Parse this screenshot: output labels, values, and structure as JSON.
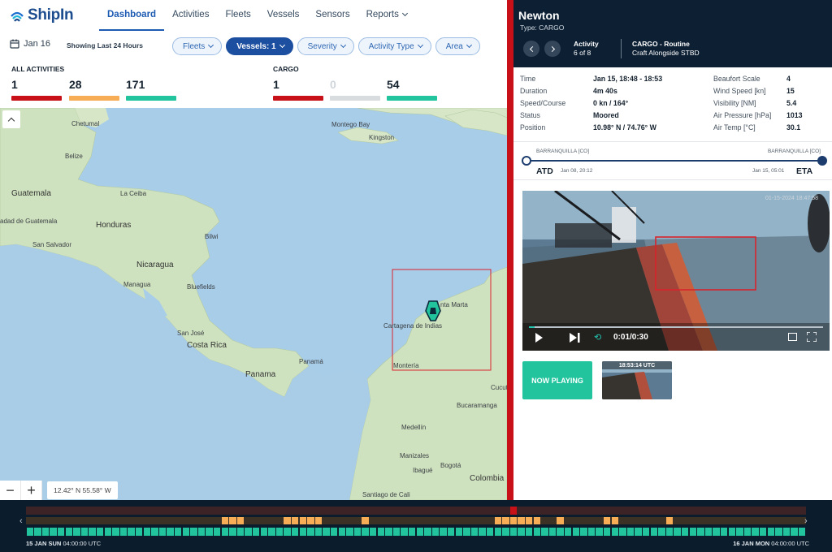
{
  "app": {
    "name": "ShipIn"
  },
  "nav": {
    "items": [
      "Dashboard",
      "Activities",
      "Fleets",
      "Vessels",
      "Sensors",
      "Reports"
    ],
    "active": "Dashboard"
  },
  "filters": {
    "date": "Jan 16",
    "showing": "Showing Last 24 Hours",
    "pills": [
      "Fleets",
      "Vessels: 1",
      "Severity",
      "Activity Type",
      "Area"
    ]
  },
  "stats": {
    "all": {
      "title": "ALL ACTIVITIES",
      "values": [
        "1",
        "28",
        "171"
      ]
    },
    "cargo": {
      "title": "CARGO",
      "values": [
        "1",
        "0",
        "54"
      ]
    },
    "colors": {
      "high": "#c81018",
      "medium": "#f6ad55",
      "low": "#22c49e",
      "none": "#d8dcdf"
    }
  },
  "map": {
    "coords": "12.42° N 55.58° W",
    "labels": {
      "chetumal": "Chetumal",
      "belize": "Belize",
      "guatemala": "Guatemala",
      "laceiba": "La Ceiba",
      "honduras": "Honduras",
      "sanpedro": "adad de Guatemala",
      "bilwi": "Bilwi",
      "salvador": "San Salvador",
      "nicaragua": "Nicaragua",
      "managua": "Managua",
      "bluefields": "Bluefields",
      "sanjose": "San José",
      "costarica": "Costa Rica",
      "panama": "Panamá",
      "panama2": "Panama",
      "montego": "Montego Bay",
      "kingston": "Kingston",
      "santamarta": "nta Marta",
      "cartagena": "Cartagena de Indias",
      "monteria": "Montería",
      "cucuta": "Cucut",
      "bucaramanga": "Bucaramanga",
      "medellin": "Medellín",
      "manizales": "Manizales",
      "ibague": "Ibagué",
      "bogota": "Bogotá",
      "colombia": "Colombia",
      "cali": "Santiago de Cali"
    }
  },
  "vessel": {
    "name": "Newton",
    "type": "Type: CARGO",
    "activity_title": "Activity",
    "activity_index": "6 of 8",
    "category": "CARGO - Routine",
    "activity_name": "Craft Alongside STBD"
  },
  "details": {
    "left": [
      {
        "label": "Time",
        "value": "Jan 15, 18:48 - 18:53"
      },
      {
        "label": "Duration",
        "value": "4m 40s"
      },
      {
        "label": "Speed/Course",
        "value": "0 kn / 164°"
      },
      {
        "label": "Status",
        "value": "Moored"
      },
      {
        "label": "Position",
        "value": "10.98° N / 74.76° W"
      }
    ],
    "right": [
      {
        "label": "Beaufort Scale",
        "value": "4"
      },
      {
        "label": "Wind Speed [kn]",
        "value": "15"
      },
      {
        "label": "Visibility [NM]",
        "value": "5.4"
      },
      {
        "label": "Air Pressure [hPa]",
        "value": "1013"
      },
      {
        "label": "Air Temp [°C]",
        "value": "30.1"
      }
    ]
  },
  "route": {
    "from_port": "BARRANQUILLA [CO]",
    "to_port": "BARRANQUILLA [CO]",
    "atd": "ATD",
    "atd_date": "Jan 08, 20:12",
    "eta": "ETA",
    "eta_date": "Jan 15, 05:01"
  },
  "video": {
    "time": "0:01/0:30",
    "stamp": "01-15-2024 18:47:58",
    "progress": 0.02,
    "now_playing": "NOW PLAYING",
    "thumb_time": "18:53:14 UTC"
  },
  "timeline": {
    "start_bold": "15 JAN SUN",
    "start_time": "04:00:00 UTC",
    "end_bold": "16 JAN MON",
    "end_time": "04:00:00 UTC",
    "high_slots": [
      62
    ],
    "medium_slots": [
      25,
      26,
      27,
      33,
      34,
      35,
      36,
      37,
      43,
      60,
      61,
      62,
      63,
      64,
      65,
      68,
      74,
      75,
      82
    ],
    "slot_count": 100
  }
}
